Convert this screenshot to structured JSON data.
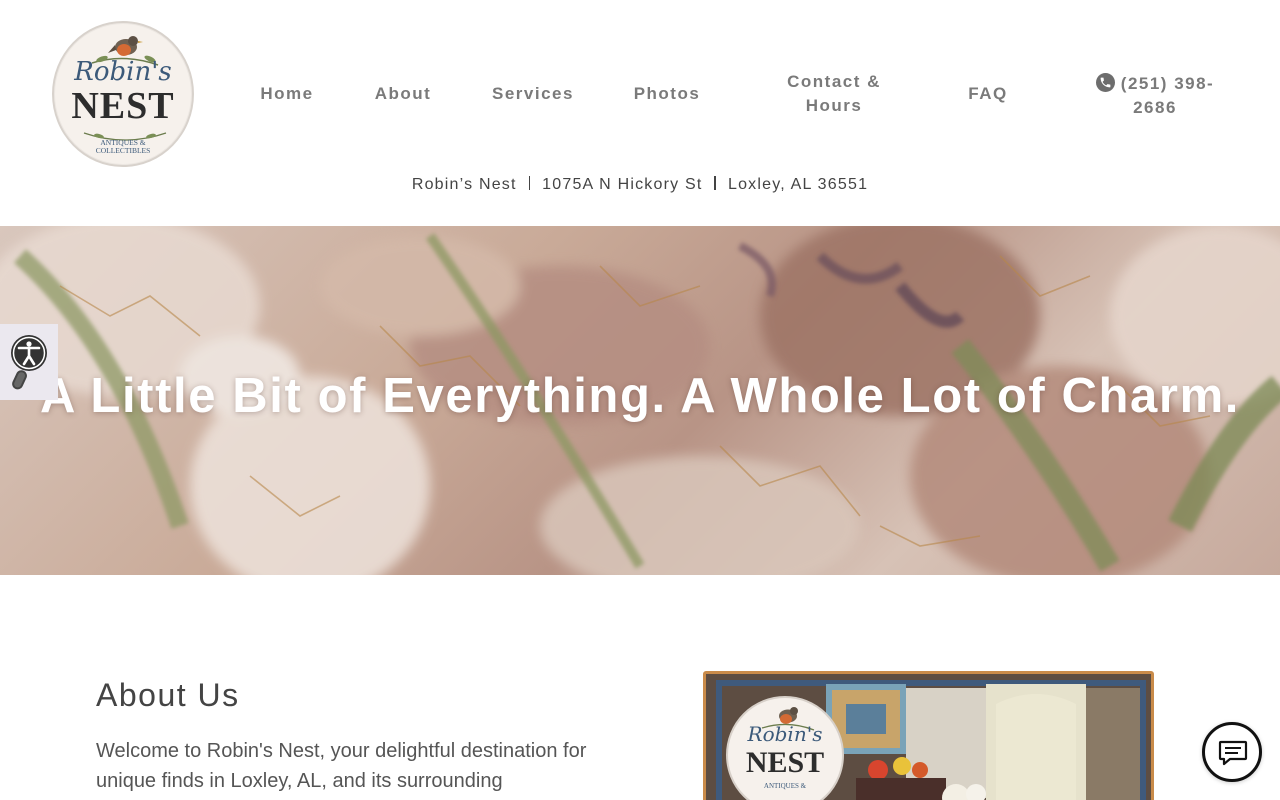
{
  "logo": {
    "script": "Robin's",
    "main": "NEST",
    "sub_line1": "ANTIQUES &",
    "sub_line2": "COLLECTIBLES"
  },
  "nav": {
    "items": [
      {
        "label": "Home"
      },
      {
        "label": "About"
      },
      {
        "label": "Services"
      },
      {
        "label": "Photos"
      },
      {
        "label": "Contact & Hours"
      },
      {
        "label": "FAQ"
      }
    ],
    "phone": "(251) 398-2686"
  },
  "address": {
    "name": "Robin’s Nest",
    "street": "1075A N Hickory St",
    "city": "Loxley, AL 36551"
  },
  "hero": {
    "title": "A Little Bit of Everything. A Whole Lot of Charm."
  },
  "about": {
    "title": "About Us",
    "text": "Welcome to Robin's Nest, your delightful destination for unique finds in Loxley, AL, and its surrounding"
  },
  "photo": {
    "logo_script": "Robin's",
    "logo_main": "NEST",
    "logo_sub": "ANTIQUES &"
  },
  "icons": {
    "phone": "phone-icon",
    "accessibility": "accessibility-icon",
    "chat": "chat-icon",
    "robin": "robin-bird-icon"
  },
  "colors": {
    "nav_text": "#7a7a7a",
    "logo_blue": "#3c5a7a",
    "photo_border": "#c98b4a",
    "hero_text": "#ffffff"
  }
}
